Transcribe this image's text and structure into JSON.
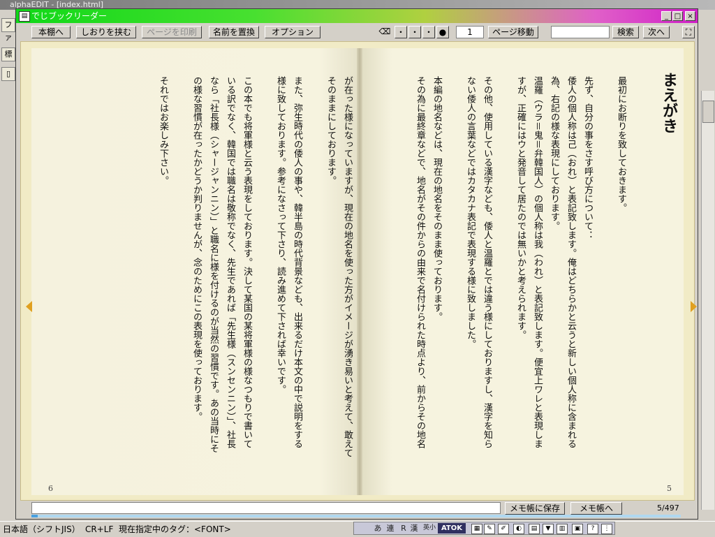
{
  "background_app": {
    "title": "alphaEDIT - [index.html]",
    "menu_first": "ファ",
    "tool_labels": [
      "標"
    ]
  },
  "window": {
    "title": "でじブックリーダー",
    "controls": {
      "minimize": "_",
      "maximize": "□",
      "close": "×"
    }
  },
  "toolbar": {
    "bookshelf": "本棚へ",
    "bookmark": "しおりを挟む",
    "print": "ページを印刷",
    "replace_name": "名前を置換",
    "options": "オプション",
    "font_sizes": [
      "・",
      "・",
      "・",
      "●"
    ],
    "page_number": "1",
    "go_page": "ページ移動",
    "search_value": "",
    "search": "検索",
    "next": "次へ"
  },
  "book": {
    "right_page": {
      "title": "まえがき",
      "page_number": "5",
      "lines": [
        "最初にお断りを致しておきます。",
        "",
        "先ず、自分の事をさす呼び方について：",
        "倭人の個人称は己（おれ）と表記致します。俺はどちらかと云うと新しい個人称に含まれる",
        "為、右記の様な表現にしております。",
        "温羅（ウラ＝鬼＝弁韓国人）の個人称は我（われ）と表記致します。便宜上ワレと表現しま",
        "すが、正確にはウと発音して居たのでは無いかと考えられます。",
        "",
        "その他、使用している漢字なども、倭人と温羅とでは違う様にしておりますし、漢字を知ら",
        "ない倭人の言葉などではカタカナ表記で表現する様に致しました。",
        "",
        "本編の地名などは、現在の地名をそのまま使っております。",
        "その為に最終章などで、地名がその件からの由来で名付けられた時点より、前からその地名"
      ]
    },
    "left_page": {
      "page_number": "6",
      "lines": [
        "が在った様になっていますが、現在の地名を使った方がイメージが湧き易いと考えて、敢えて",
        "そのままにしております。",
        "",
        "また、弥生時代の倭人の事や、韓半島の時代背景なども、出来るだけ本文の中で説明をする",
        "様に致しております。参考になさって下さり、読み進めて下されば幸いです。",
        "",
        "この本でも将軍様と云う表現をしております。決して某国の某将軍様の様なつもりで書いて",
        "いる訳でなく、韓国では職名は敬称でなく、先生であれば「先生様（スンセンニン）」、社長",
        "なら「社長様（シャージャンニン）」と職名に様を付けるのが当然の習慣です。あの当時にそ",
        "の様な習慣が在ったかどうか判りませんが、念のためにこの表現を使っております。",
        "",
        "それではお楽しみ下さい。"
      ]
    }
  },
  "bottom": {
    "memo_value": "",
    "save_memo": "メモ帳に保存",
    "to_memo": "メモ帳へ",
    "page_count": "5/497",
    "progress": 0.01
  },
  "status": {
    "encoding": "日本語（シフトJIS）",
    "line_ending": "CR+LF",
    "current_tag": "現在指定中のタグ：<FONT>"
  },
  "ime": {
    "labels": [
      "あ",
      "連",
      "R",
      "漢",
      "英小",
      "ATOK"
    ]
  }
}
